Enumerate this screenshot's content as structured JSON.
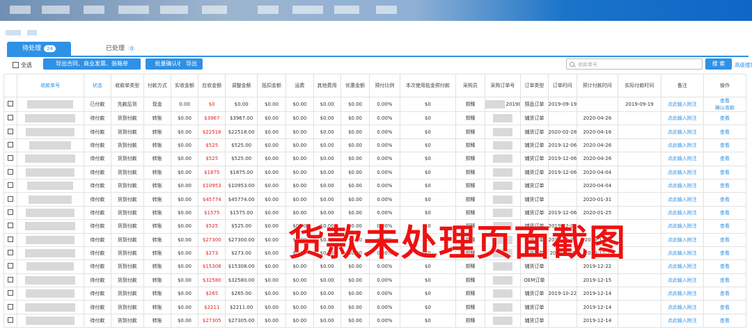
{
  "tabs": [
    {
      "label": "待处理",
      "count": "24"
    },
    {
      "label": "已处理",
      "count": "0"
    }
  ],
  "toolbar": {
    "select_all": "全选",
    "buttons": [
      "导出合同、商业发票、装箱单",
      "批量确认收款",
      "导出"
    ],
    "search_placeholder": "收款单号",
    "search_button": "搜 索",
    "advanced_search": "高级搜索"
  },
  "columns": [
    "收款单号",
    "状态",
    "收款单类型",
    "付款方式",
    "实收金额",
    "应收金额",
    "调整金额",
    "抵扣金额",
    "运费",
    "其他费用",
    "优惠金额",
    "预付比例",
    "本次使用抵金预付款",
    "采购员",
    "采购订单号",
    "订单类型",
    "订单时间",
    "预计付款时间",
    "实际付款时间",
    "备注",
    "操作"
  ],
  "rows": [
    [
      "",
      "已付款",
      "先款后货",
      "现金",
      "0.00",
      "$0",
      "$0.00",
      "$0.00",
      "$0.00",
      "$0.00",
      "$0.00",
      "0.00%",
      "$0",
      "郑臻",
      "2019091",
      "预品订单",
      "2019-09-19",
      "",
      "2019-09-19",
      "点此输入附注",
      [
        "查看",
        "确认收款"
      ]
    ],
    [
      "",
      "待付款",
      "货到付款",
      "转账",
      "$0.00",
      "$3967",
      "$3967.00",
      "$0.00",
      "$0.00",
      "$0.00",
      "$0.00",
      "0.00%",
      "$0",
      "郑臻",
      "",
      "铺货订单",
      "",
      "2020-04-26",
      "",
      "点此输入附注",
      [
        "查看"
      ]
    ],
    [
      "",
      "待付款",
      "货到付款",
      "转账",
      "$0.00",
      "$22518",
      "$22518.00",
      "$0.00",
      "$0.00",
      "$0.00",
      "$0.00",
      "0.00%",
      "$0",
      "郑臻",
      "",
      "铺货订单",
      "2020-02-28",
      "2020-04-16",
      "",
      "点此输入附注",
      [
        "查看"
      ]
    ],
    [
      "",
      "待付款",
      "货到付款",
      "转账",
      "$0.00",
      "$525",
      "$525.00",
      "$0.00",
      "$0.00",
      "$0.00",
      "$0.00",
      "0.00%",
      "$0",
      "郑臻",
      "",
      "铺货订单",
      "2019-12-06",
      "2020-04-26",
      "",
      "点此输入附注",
      [
        "查看"
      ]
    ],
    [
      "",
      "待付款",
      "货到付款",
      "转账",
      "$0.00",
      "$525",
      "$525.00",
      "$0.00",
      "$0.00",
      "$0.00",
      "$0.00",
      "0.00%",
      "$0",
      "郑臻",
      "",
      "铺货订单",
      "2019-12-06",
      "2020-04-26",
      "",
      "点此输入附注",
      [
        "查看"
      ]
    ],
    [
      "",
      "待付款",
      "货到付款",
      "转账",
      "$0.00",
      "$1875",
      "$1875.00",
      "$0.00",
      "$0.00",
      "$0.00",
      "$0.00",
      "0.00%",
      "$0",
      "郑臻",
      "",
      "铺货订单",
      "2019-12-06",
      "2020-04-04",
      "",
      "点此输入附注",
      [
        "查看"
      ]
    ],
    [
      "",
      "待付款",
      "货到付款",
      "转账",
      "$0.00",
      "$10953",
      "$10953.00",
      "$0.00",
      "$0.00",
      "$0.00",
      "$0.00",
      "0.00%",
      "$0",
      "郑臻",
      "",
      "铺货订单",
      "",
      "2020-04-04",
      "",
      "点此输入附注",
      [
        "查看"
      ]
    ],
    [
      "",
      "待付款",
      "货到付款",
      "转账",
      "$0.00",
      "$45774",
      "$45774.00",
      "$0.00",
      "$0.00",
      "$0.00",
      "$0.00",
      "0.00%",
      "$0",
      "郑臻",
      "",
      "铺货订单",
      "",
      "2020-01-31",
      "",
      "点此输入附注",
      [
        "查看"
      ]
    ],
    [
      "",
      "待付款",
      "货到付款",
      "转账",
      "$0.00",
      "$1575",
      "$1575.00",
      "$0.00",
      "$0.00",
      "$0.00",
      "$0.00",
      "0.00%",
      "$0",
      "郑臻",
      "",
      "铺货订单",
      "2019-12-06",
      "2020-01-25",
      "",
      "点此输入附注",
      [
        "查看"
      ]
    ],
    [
      "",
      "待付款",
      "货到付款",
      "转账",
      "$0.00",
      "$525",
      "$525.00",
      "$0.00",
      "$0.00",
      "$0.00",
      "$0.00",
      "0.00%",
      "$0",
      "郑臻",
      "",
      "铺货订单",
      "2019-12-06",
      "",
      "",
      "点此输入附注",
      [
        "查看"
      ]
    ],
    [
      "",
      "待付款",
      "货到付款",
      "转账",
      "$0.00",
      "$27300",
      "$27300.00",
      "$0.00",
      "$0.00",
      "$0.00",
      "$0.00",
      "0.00%",
      "$0",
      "郑臻",
      "",
      "铺货订单",
      "2019-10-21",
      "2019-12-2",
      "",
      "点此输入附注",
      [
        "查看"
      ]
    ],
    [
      "",
      "待付款",
      "货到付款",
      "转账",
      "$0.00",
      "$273",
      "$273.00",
      "$0.00",
      "$0.00",
      "$0.00",
      "$0.00",
      "0.00%",
      "$0",
      "郑臻",
      "",
      "铺货订单",
      "2019-10-2",
      "2019-12-2",
      "",
      "点此输入附注",
      [
        "查看"
      ]
    ],
    [
      "",
      "待付款",
      "货到付款",
      "转账",
      "$0.00",
      "$15308",
      "$15308.00",
      "$0.00",
      "$0.00",
      "$0.00",
      "$0.00",
      "0.00%",
      "$0",
      "郑臻",
      "",
      "铺货订单",
      "",
      "2019-12-22",
      "",
      "点此输入附注",
      [
        "查看"
      ]
    ],
    [
      "",
      "待付款",
      "货到付款",
      "转账",
      "$0.00",
      "$32580",
      "$32580.00",
      "$0.00",
      "$0.00",
      "$0.00",
      "$0.00",
      "0.00%",
      "$0",
      "郑臻",
      "",
      "OEM订单",
      "",
      "2019-12-15",
      "",
      "点此输入附注",
      [
        "查看"
      ]
    ],
    [
      "",
      "待付款",
      "货到付款",
      "转账",
      "$0.00",
      "$265",
      "$265.00",
      "$0.00",
      "$0.00",
      "$0.00",
      "$0.00",
      "0.00%",
      "$0",
      "郑臻",
      "",
      "铺货订单",
      "2019-10-22",
      "2019-12-14",
      "",
      "点此输入附注",
      [
        "查看"
      ]
    ],
    [
      "",
      "待付款",
      "货到付款",
      "转账",
      "$0.00",
      "$2211",
      "$2211.00",
      "$0.00",
      "$0.00",
      "$0.00",
      "$0.00",
      "0.00%",
      "$0",
      "郑臻",
      "",
      "铺货订单",
      "",
      "2019-12-14",
      "",
      "点此输入附注",
      [
        "查看"
      ]
    ],
    [
      "",
      "待付款",
      "货到付款",
      "转账",
      "$0.00",
      "$27305",
      "$27305.00",
      "$0.00",
      "$0.00",
      "$0.00",
      "$0.00",
      "0.00%",
      "$0",
      "郑臻",
      "",
      "铺货订单",
      "",
      "2019-12-14",
      "",
      "点此输入附注",
      [
        "查看"
      ]
    ]
  ],
  "overlay_text": "货款未处理页面截图",
  "colors": {
    "accent": "#2e91e6",
    "amount_red": "#e02020",
    "overlay_red": "#ee1111"
  }
}
